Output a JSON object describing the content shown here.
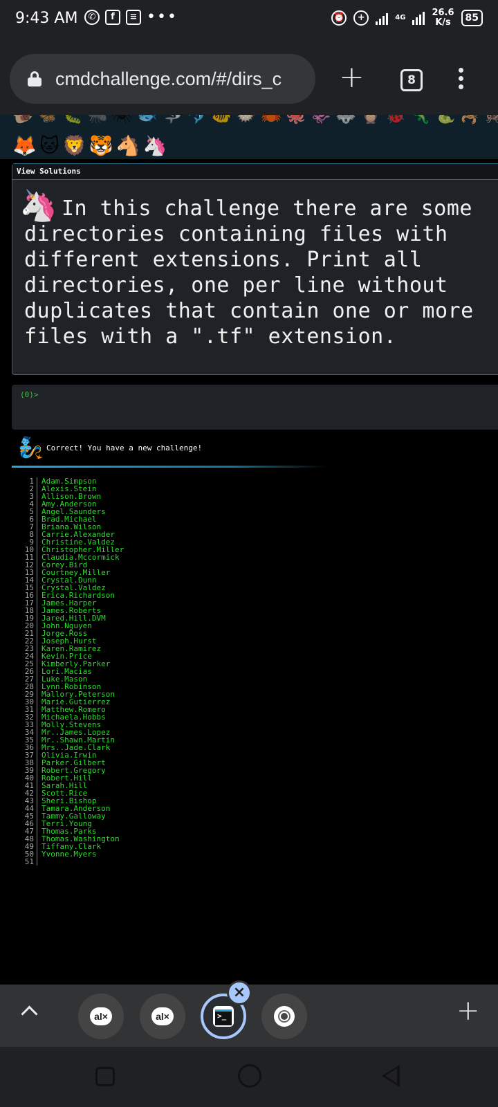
{
  "status_bar": {
    "time": "9:43 AM",
    "network_type": "4G",
    "speed_value": "26.6",
    "speed_unit": "K/s",
    "battery": "85"
  },
  "browser": {
    "url": "cmdchallenge.com/#/dirs_c",
    "tab_count": "8"
  },
  "emoji_strip": {
    "row_top": "🐌🦋🐛🐜🕷🐟🦈🐬🐠🐡🦀🐙🦑🐺🦉🐞🦎🐍🦂🦗🐝🐞🪱🦠",
    "row_bottom": "🦊🐱🦁🐯🐴🦄"
  },
  "panel": {
    "tab_label": "View Solutions",
    "unicorn_icon": "unicorn",
    "challenge_text": "In this challenge there are some directories containing files with different extensions. Print all directories, one per line without duplicates that contain one or more files with a \".tf\" extension."
  },
  "prompt": {
    "text": "(0)>"
  },
  "result": {
    "genie_icon": "genie",
    "message": "Correct! You have a new challenge!"
  },
  "output": {
    "lines": [
      "Adam.Simpson",
      "Alexis.Stein",
      "Allison.Brown",
      "Amy.Anderson",
      "Angel.Saunders",
      "Brad.Michael",
      "Briana.Wilson",
      "Carrie.Alexander",
      "Christine.Valdez",
      "Christopher.Miller",
      "Claudia.Mccormick",
      "Corey.Bird",
      "Courtney.Miller",
      "Crystal.Dunn",
      "Crystal.Valdez",
      "Erica.Richardson",
      "James.Harper",
      "James.Roberts",
      "Jared.Hill.DVM",
      "John.Nguyen",
      "Jorge.Ross",
      "Joseph.Hurst",
      "Karen.Ramirez",
      "Kevin.Price",
      "Kimberly.Parker",
      "Lori.Macias",
      "Luke.Mason",
      "Lynn.Robinson",
      "Mallory.Peterson",
      "Marie.Gutierrez",
      "Matthew.Romero",
      "Michaela.Hobbs",
      "Molly.Stevens",
      "Mr..James.Lopez",
      "Mr..Shawn.Martin",
      "Mrs..Jade.Clark",
      "Olivia.Irwin",
      "Parker.Gilbert",
      "Robert.Gregory",
      "Robert.Hill",
      "Sarah.Hill",
      "Scott.Rice",
      "Sheri.Bishop",
      "Tamara.Anderson",
      "Tammy.Galloway",
      "Terri.Young",
      "Thomas.Parks",
      "Thomas.Washington",
      "Tiffany.Clark",
      "Yvonne.Myers",
      ""
    ]
  },
  "tabstrip": {
    "tab1_label": "al×",
    "tab2_label": "al×",
    "close_symbol": "×",
    "new_tab_symbol": "+"
  },
  "colors": {
    "terminal_green": "#2ddc2d",
    "panel_border": "#2c6a8a",
    "progress": "#2aa8d8"
  }
}
